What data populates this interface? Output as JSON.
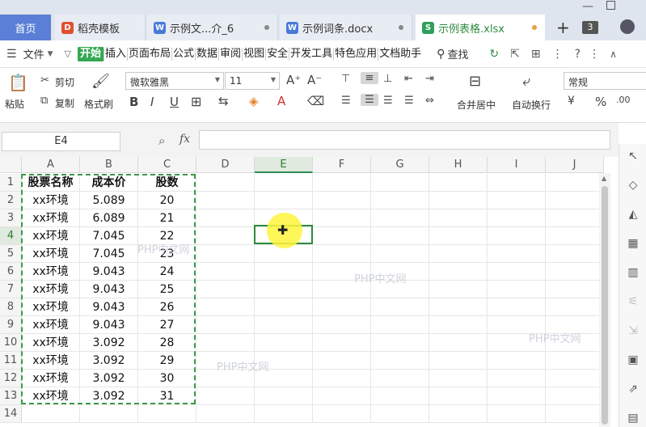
{
  "tabs": {
    "home": "首页",
    "items": [
      {
        "label": "稻壳模板",
        "icon": "D",
        "color": "#e0502f"
      },
      {
        "label": "示例文...介_6",
        "icon": "W",
        "color": "#4a79d9"
      },
      {
        "label": "示例词条.docx",
        "icon": "W",
        "color": "#4a79d9"
      },
      {
        "label": "示例表格.xlsx",
        "icon": "S",
        "color": "#2ea05a"
      }
    ],
    "add": "+",
    "count": "3"
  },
  "menu": {
    "file": "文件",
    "items": [
      "开始",
      "插入",
      "页面布局",
      "公式",
      "数据",
      "审阅",
      "视图",
      "安全",
      "开发工具",
      "特色应用",
      "文档助手"
    ],
    "active": "开始",
    "search": "查找"
  },
  "ribbon": {
    "paste": "粘贴",
    "cut": "剪切",
    "copy": "复制",
    "format_painter": "格式刷",
    "font_name": "微软雅黑",
    "font_size": "11",
    "merge": "合并居中",
    "wrap": "自动换行",
    "number_format": "常规"
  },
  "formula_bar": {
    "name_box": "E4",
    "fx": "fx"
  },
  "grid": {
    "columns": [
      "A",
      "B",
      "C",
      "D",
      "E",
      "F",
      "G",
      "H",
      "I",
      "J"
    ],
    "rows": [
      "1",
      "2",
      "3",
      "4",
      "5",
      "6",
      "7",
      "8",
      "9",
      "10",
      "11",
      "12",
      "13",
      "14"
    ],
    "selected_column": "E",
    "selected_row": "4",
    "header": [
      "股票名称",
      "成本价",
      "股数"
    ],
    "data": [
      [
        "xx环境",
        "5.089",
        "20"
      ],
      [
        "xx环境",
        "6.089",
        "21"
      ],
      [
        "xx环境",
        "7.045",
        "22"
      ],
      [
        "xx环境",
        "7.045",
        "23"
      ],
      [
        "xx环境",
        "9.043",
        "24"
      ],
      [
        "xx环境",
        "9.043",
        "25"
      ],
      [
        "xx环境",
        "9.043",
        "26"
      ],
      [
        "xx环境",
        "9.043",
        "27"
      ],
      [
        "xx环境",
        "3.092",
        "28"
      ],
      [
        "xx环境",
        "3.092",
        "29"
      ],
      [
        "xx环境",
        "3.092",
        "30"
      ],
      [
        "xx环境",
        "3.092",
        "31"
      ]
    ]
  },
  "watermark": "PHP中文网",
  "colors": {
    "accent_green": "#2e8b3e",
    "home_tab": "#5b7fd6",
    "menu_active": "#34a853"
  }
}
